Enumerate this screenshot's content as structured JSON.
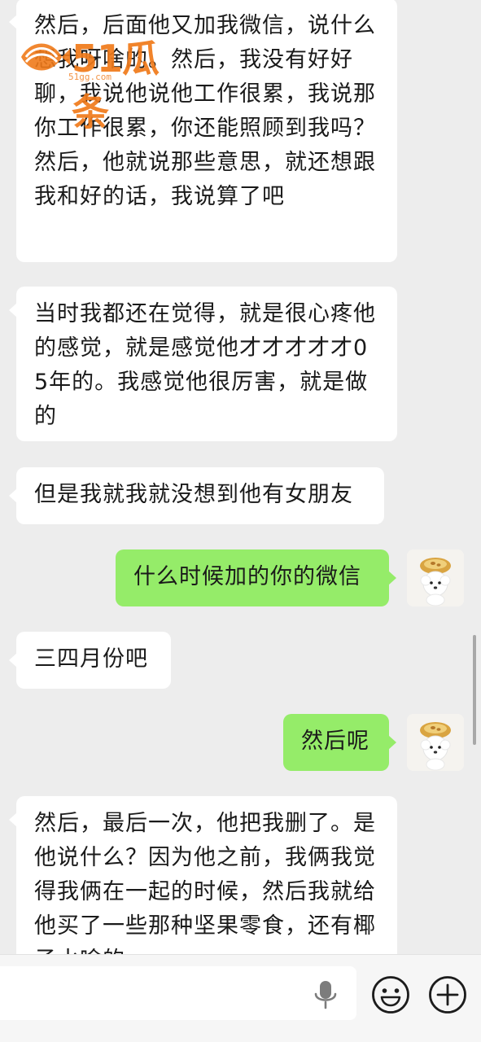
{
  "messages": [
    {
      "side": "left",
      "text": "然后，后面他又加我微信，说什么想我呀啥的。然后，我没有好好聊，我说他说他工作很累，我说那你工作很累，你还能照顾到我吗？然后，他就说那些意思，就还想跟我和好的话，我说算了吧"
    },
    {
      "side": "left",
      "text": "当时我都还在觉得，就是很心疼他的感觉，就是感觉他才才才才才05年的。我感觉他很厉害，就是做的"
    },
    {
      "side": "left",
      "text": "但是我就我就没想到他有女朋友"
    },
    {
      "side": "right",
      "text": "什么时候加的你的微信"
    },
    {
      "side": "left",
      "text": "三四月份吧"
    },
    {
      "side": "right",
      "text": "然后呢"
    },
    {
      "side": "left",
      "text": "然后，最后一次，他把我删了。是他说什么？因为他之前，我俩我觉得我俩在一起的时候，然后我就给他买了一些那种坚果零食，还有椰子水啥的"
    }
  ],
  "watermark": {
    "text": "51瓜条",
    "url": "51gg.com"
  },
  "input_bar": {
    "mic_icon": "microphone-icon",
    "emoji_icon": "emoji-smile-icon",
    "plus_icon": "plus-icon"
  },
  "colors": {
    "background": "#ededed",
    "incoming_bubble": "#ffffff",
    "outgoing_bubble": "#95ec69",
    "watermark": "#f07a1a"
  }
}
